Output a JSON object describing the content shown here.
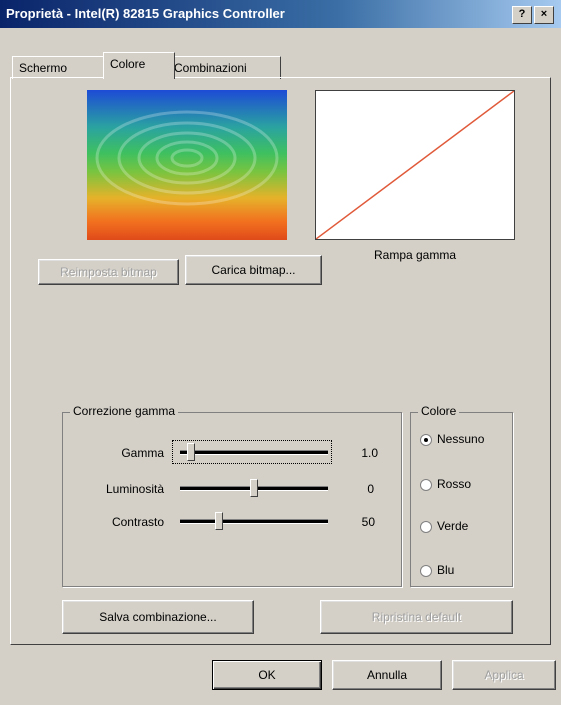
{
  "window": {
    "title": "Proprietà - Intel(R) 82815 Graphics Controller",
    "help_btn": "?",
    "close_btn": "×"
  },
  "tabs": [
    {
      "label": "Schermo"
    },
    {
      "label": "Colore",
      "active": true
    },
    {
      "label": "Combinazioni"
    }
  ],
  "gamma_ramp": {
    "label": "Rampa gamma",
    "line_color": "#e05a3a"
  },
  "bitmap": {
    "reset_label": "Reimposta bitmap",
    "load_label": "Carica bitmap..."
  },
  "gamma_correction": {
    "legend": "Correzione gamma",
    "rows": [
      {
        "label": "Gamma",
        "value": "1.0",
        "level": 0.05
      },
      {
        "label": "Luminosità",
        "value": "0",
        "level": 0.5
      },
      {
        "label": "Contrasto",
        "value": "50",
        "level": 0.25
      }
    ]
  },
  "color_group": {
    "legend": "Colore",
    "options": [
      {
        "label": "Nessuno",
        "selected": true
      },
      {
        "label": "Rosso",
        "selected": false
      },
      {
        "label": "Verde",
        "selected": false
      },
      {
        "label": "Blu",
        "selected": false
      }
    ]
  },
  "actions": {
    "save_label": "Salva combinazione...",
    "restore_label": "Ripristina default"
  },
  "footer": {
    "ok": "OK",
    "cancel": "Annulla",
    "apply": "Applica"
  }
}
